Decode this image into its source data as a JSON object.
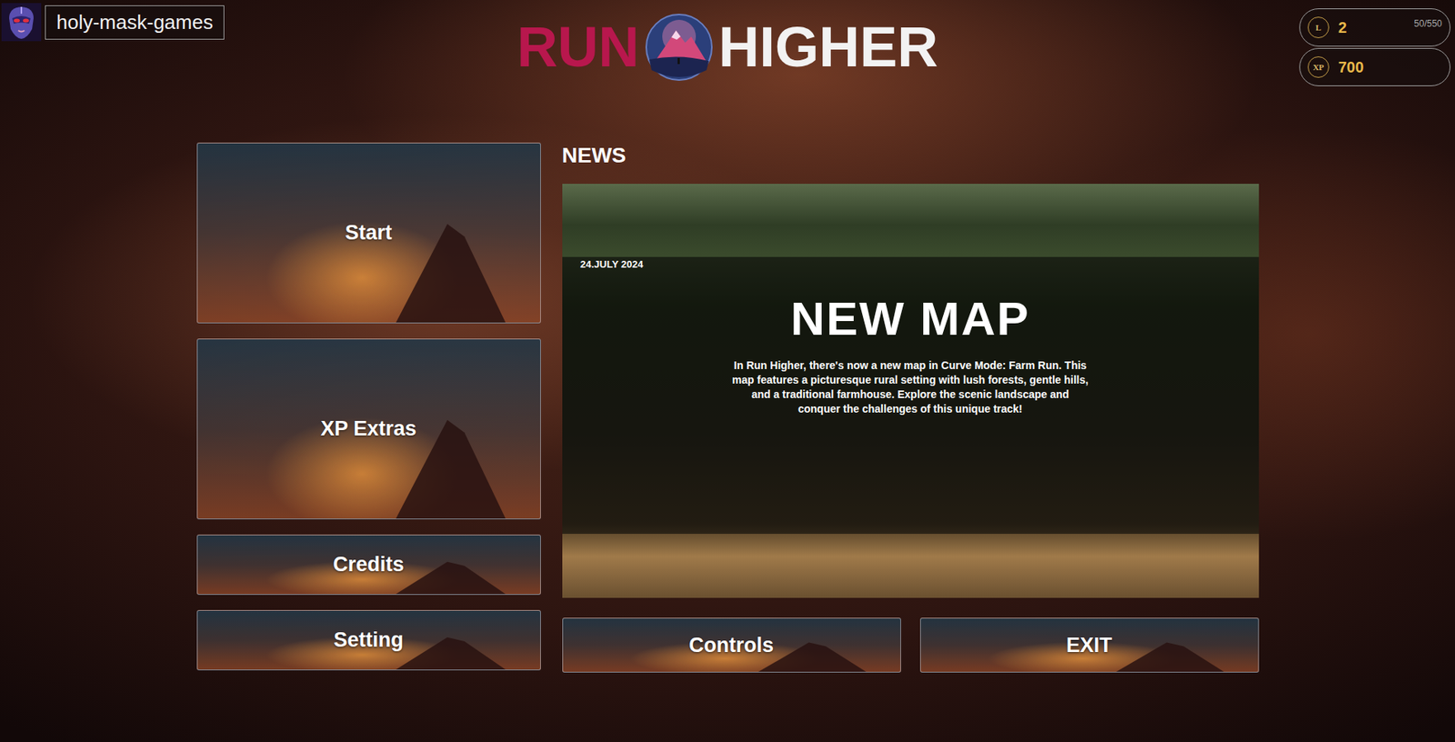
{
  "user": {
    "name": "holy-mask-games"
  },
  "title": {
    "left": "RUN",
    "right": "HIGHER"
  },
  "stats": [
    {
      "icon": "L",
      "value": "2",
      "progress": "50/550"
    },
    {
      "icon": "XP",
      "value": "700",
      "progress": ""
    }
  ],
  "menu": [
    {
      "label": "Start",
      "kind": "tall"
    },
    {
      "label": "XP Extras",
      "kind": "tall"
    },
    {
      "label": "Credits",
      "kind": "short"
    },
    {
      "label": "Setting",
      "kind": "short"
    }
  ],
  "news": {
    "heading": "NEWS",
    "date": "24.JULY 2024",
    "title": "NEW MAP",
    "body": "In Run Higher, there's now a new map in Curve Mode: Farm Run. This map features a picturesque rural setting with lush forests, gentle hills, and a traditional farmhouse. Explore the scenic landscape and conquer the challenges of this unique track!"
  },
  "actions": [
    "Controls",
    "EXIT"
  ]
}
